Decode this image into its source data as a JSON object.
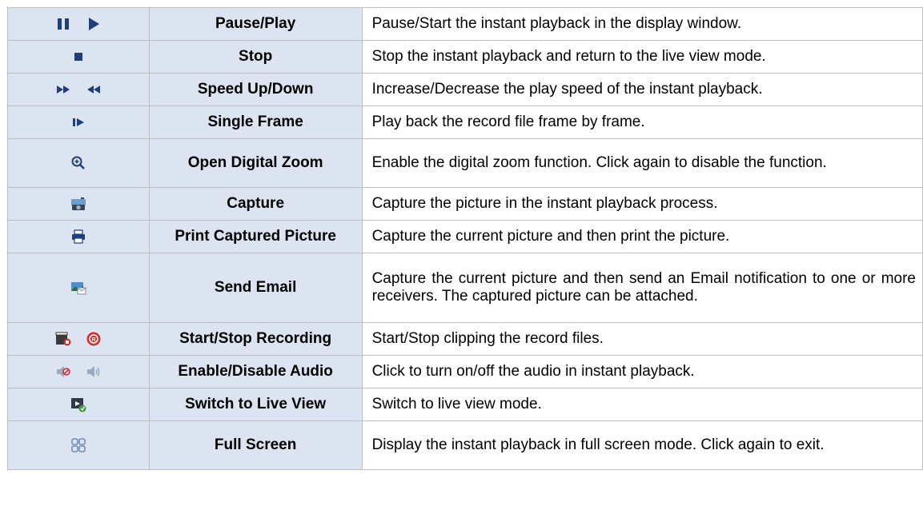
{
  "rows": [
    {
      "icons": [
        "pause-icon",
        "play-icon"
      ],
      "name": "Pause/Play",
      "desc": "Pause/Start the instant playback in the display window."
    },
    {
      "icons": [
        "stop-icon"
      ],
      "name": "Stop",
      "desc": "Stop the instant playback and return to the live view mode."
    },
    {
      "icons": [
        "fast-forward-icon",
        "rewind-icon"
      ],
      "name": "Speed Up/Down",
      "desc": "Increase/Decrease the play speed of the instant playback."
    },
    {
      "icons": [
        "single-frame-icon"
      ],
      "name": "Single Frame",
      "desc": "Play back the record file frame by frame."
    },
    {
      "icons": [
        "zoom-in-icon"
      ],
      "name": "Open Digital Zoom",
      "desc": "Enable the digital zoom function. Click again to disable the function."
    },
    {
      "icons": [
        "camera-icon"
      ],
      "name": "Capture",
      "desc": "Capture the picture in the instant playback process."
    },
    {
      "icons": [
        "printer-icon"
      ],
      "name": "Print Captured Picture",
      "desc": "Capture the current picture and then print the picture."
    },
    {
      "icons": [
        "email-icon"
      ],
      "name": "Send Email",
      "desc": "Capture the current picture and then send an Email notification to one or more receivers. The captured picture can be attached."
    },
    {
      "icons": [
        "clip-record-icon",
        "record-icon"
      ],
      "name": "Start/Stop Recording",
      "desc": "Start/Stop clipping the record files."
    },
    {
      "icons": [
        "audio-off-icon",
        "audio-on-icon"
      ],
      "name": "Enable/Disable Audio",
      "desc": "Click to turn on/off the audio in instant playback."
    },
    {
      "icons": [
        "live-view-icon"
      ],
      "name": "Switch to Live View",
      "desc": "Switch to live view mode."
    },
    {
      "icons": [
        "fullscreen-icon"
      ],
      "name": "Full Screen",
      "desc": "Display the instant playback in full screen mode. Click again to exit."
    }
  ],
  "colors": {
    "header_bg": "#dbe4f0",
    "border": "#bfbfbf",
    "icon_blue": "#1f3f7a",
    "record_red": "#d32f2f"
  }
}
